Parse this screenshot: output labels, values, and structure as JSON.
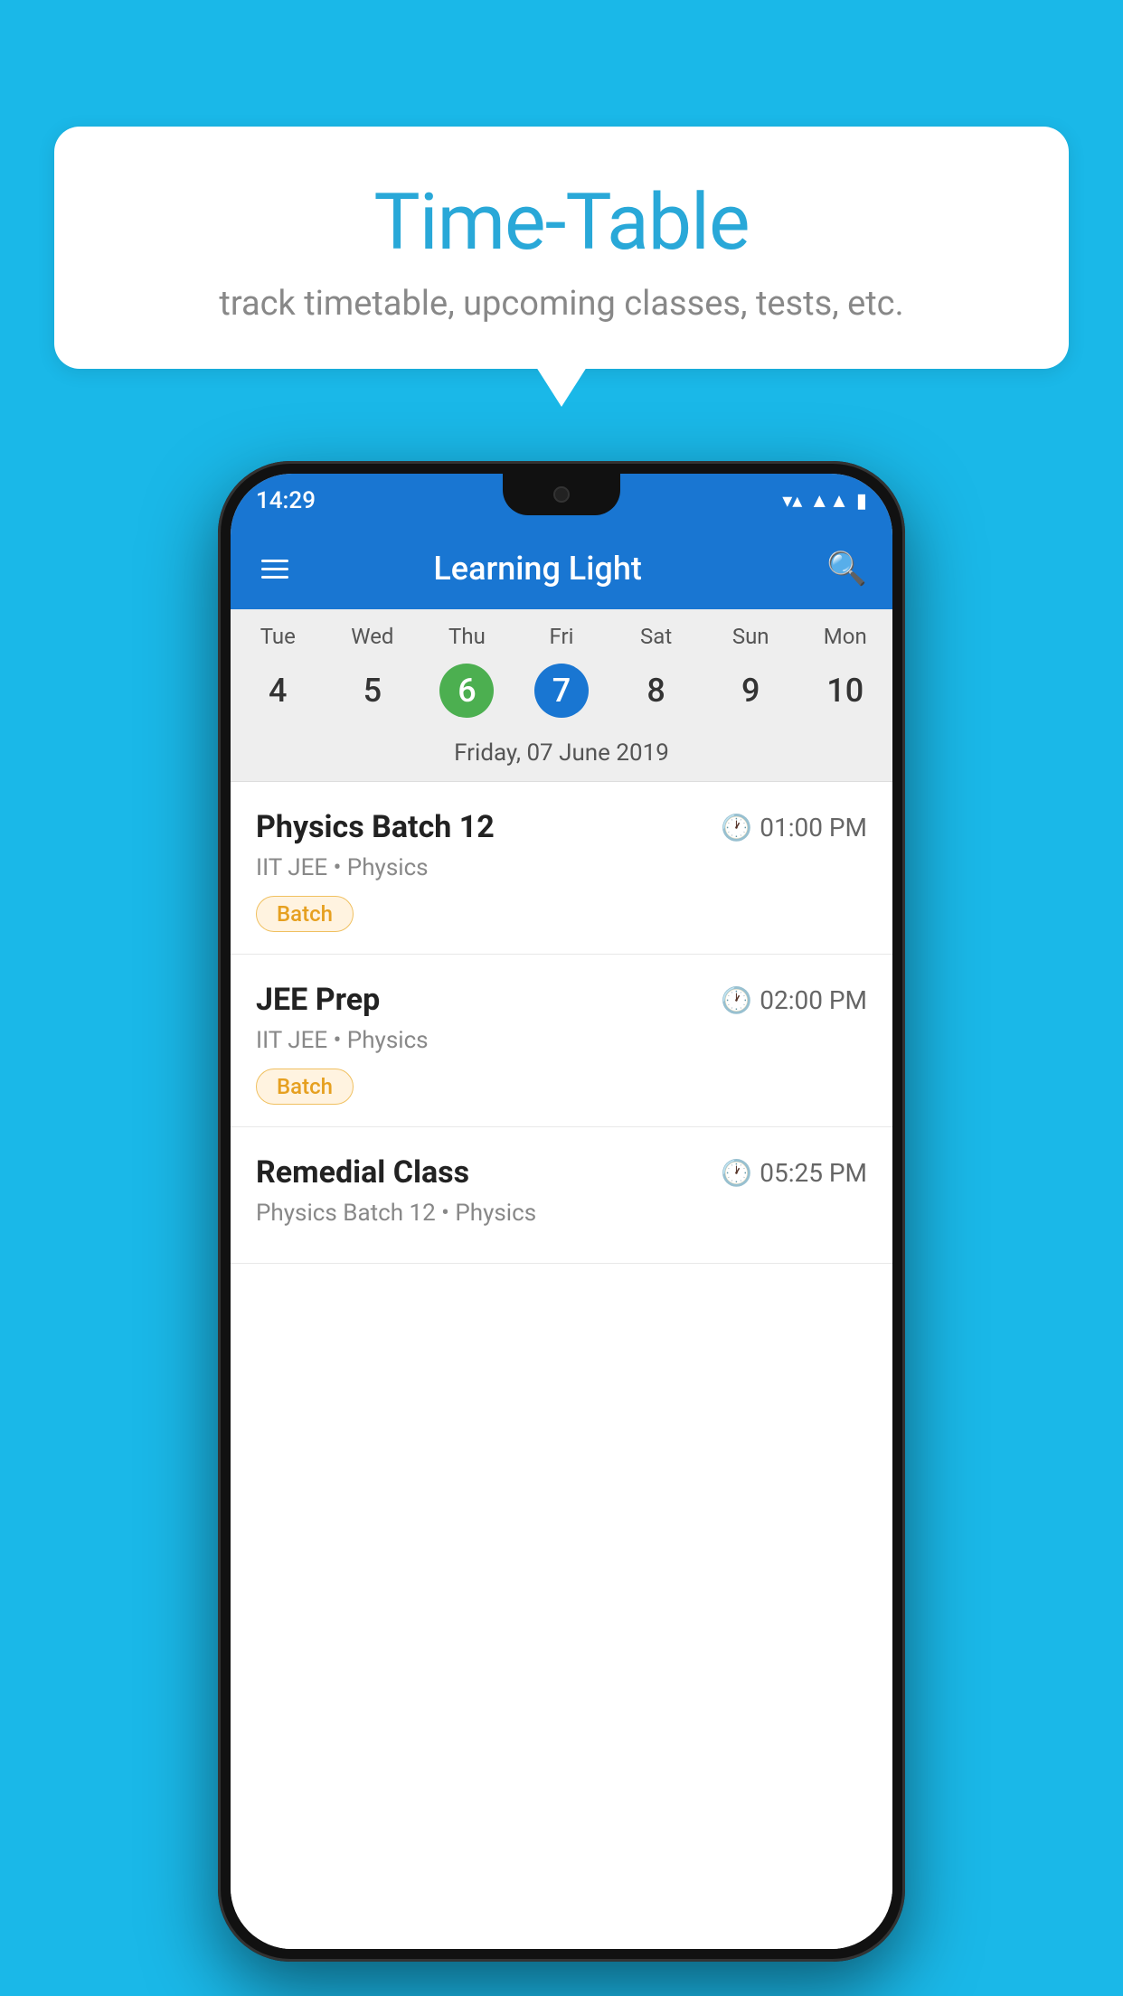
{
  "background_color": "#1ab8e8",
  "speech_bubble": {
    "title": "Time-Table",
    "subtitle": "track timetable, upcoming classes, tests, etc."
  },
  "phone": {
    "status_bar": {
      "time": "14:29"
    },
    "app_bar": {
      "title": "Learning Light"
    },
    "calendar": {
      "days": [
        {
          "name": "Tue",
          "number": "4",
          "state": "normal"
        },
        {
          "name": "Wed",
          "number": "5",
          "state": "normal"
        },
        {
          "name": "Thu",
          "number": "6",
          "state": "today"
        },
        {
          "name": "Fri",
          "number": "7",
          "state": "selected"
        },
        {
          "name": "Sat",
          "number": "8",
          "state": "normal"
        },
        {
          "name": "Sun",
          "number": "9",
          "state": "normal"
        },
        {
          "name": "Mon",
          "number": "10",
          "state": "normal"
        }
      ],
      "selected_date_label": "Friday, 07 June 2019"
    },
    "schedule": [
      {
        "title": "Physics Batch 12",
        "time": "01:00 PM",
        "subtitle": "IIT JEE • Physics",
        "badge": "Batch"
      },
      {
        "title": "JEE Prep",
        "time": "02:00 PM",
        "subtitle": "IIT JEE • Physics",
        "badge": "Batch"
      },
      {
        "title": "Remedial Class",
        "time": "05:25 PM",
        "subtitle": "Physics Batch 12 • Physics",
        "badge": null
      }
    ]
  }
}
